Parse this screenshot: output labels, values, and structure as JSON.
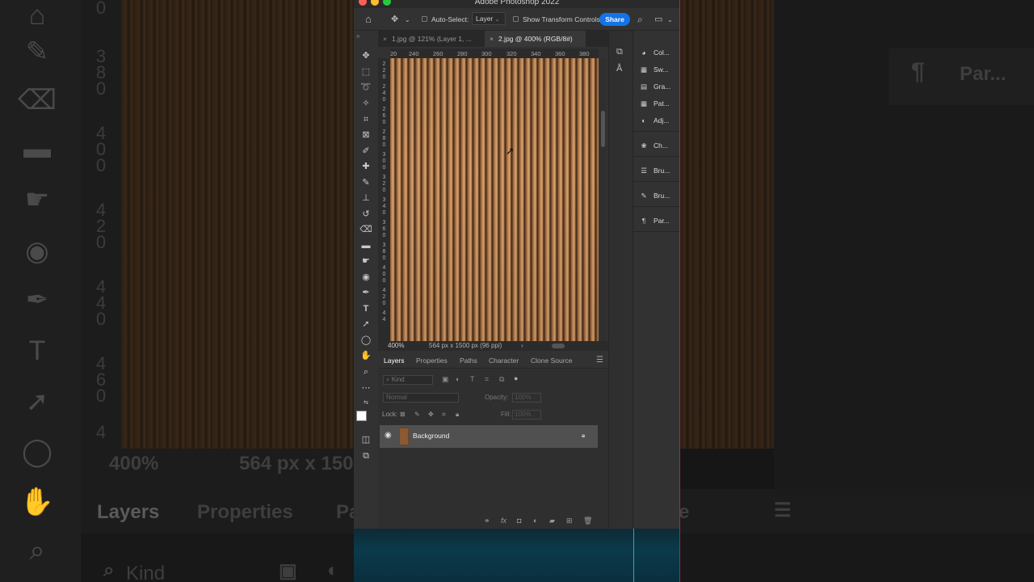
{
  "window": {
    "title": "Adobe Photoshop 2022"
  },
  "options_bar": {
    "auto_select_label": "Auto-Select:",
    "auto_select_value": "Layer",
    "transform_label": "Show Transform Controls",
    "share_label": "Share"
  },
  "tabs": [
    {
      "label": "1.jpg @ 121% (Layer 1, ..."
    },
    {
      "label": "2.jpg @ 400% (RGB/8#)"
    }
  ],
  "ruler_h": [
    "20",
    "240",
    "260",
    "280",
    "300",
    "320",
    "340",
    "360",
    "380"
  ],
  "ruler_v": [
    "2",
    "2",
    "0",
    "2",
    "4",
    "0",
    "2",
    "6",
    "0",
    "2",
    "8",
    "0",
    "3",
    "0",
    "0",
    "3",
    "2",
    "0",
    "3",
    "4",
    "0",
    "3",
    "6",
    "0",
    "3",
    "8",
    "0",
    "4",
    "0",
    "0",
    "4",
    "2",
    "0",
    "4",
    "4"
  ],
  "status": {
    "zoom": "400%",
    "dimensions": "564 px x 1500 px (96 ppi)",
    "arrow": "›"
  },
  "side_panels": [
    {
      "label": "Col...",
      "icon": "color-wheel-icon",
      "glyph": "◕"
    },
    {
      "label": "Sw...",
      "icon": "swatches-icon",
      "glyph": "▦"
    },
    {
      "label": "Gra...",
      "icon": "gradient-icon",
      "glyph": "▤"
    },
    {
      "label": "Pat...",
      "icon": "patterns-icon",
      "glyph": "▦"
    },
    {
      "label": "Adj...",
      "icon": "adjustments-icon",
      "glyph": "◐"
    },
    {
      "label": "Ch...",
      "icon": "channels-icon",
      "glyph": "❀"
    },
    {
      "label": "Bru...",
      "icon": "brush-settings-icon",
      "glyph": "☰"
    },
    {
      "label": "Bru...",
      "icon": "brushes-icon",
      "glyph": "✎"
    },
    {
      "label": "Par...",
      "icon": "paragraph-icon",
      "glyph": "¶"
    }
  ],
  "layers_panel": {
    "tabs": [
      "Layers",
      "Properties",
      "Paths",
      "Character",
      "Clone Source"
    ],
    "kind_placeholder": "Kind",
    "blend_mode": "Normal",
    "opacity_label": "Opacity:",
    "opacity_value": "100%",
    "lock_label": "Lock:",
    "fill_label": "Fill:",
    "fill_value": "100%",
    "layers": [
      {
        "name": "Background"
      }
    ]
  },
  "background": {
    "zoom": "400%",
    "dimensions": "564 px x 150",
    "layers_tab": "Layers",
    "properties_tab": "Properties",
    "pa_tab": "Pa",
    "e_tab": "e",
    "kind": "Kind",
    "par": "Par...",
    "ruler_digits": [
      "0",
      "3",
      "8",
      "0",
      "4",
      "0",
      "0",
      "4",
      "2",
      "0",
      "4",
      "4",
      "0",
      "4",
      "6",
      "0",
      "4"
    ]
  },
  "colors": {
    "accent": "#1473e6",
    "canvas_wood": "#c08a5a"
  }
}
